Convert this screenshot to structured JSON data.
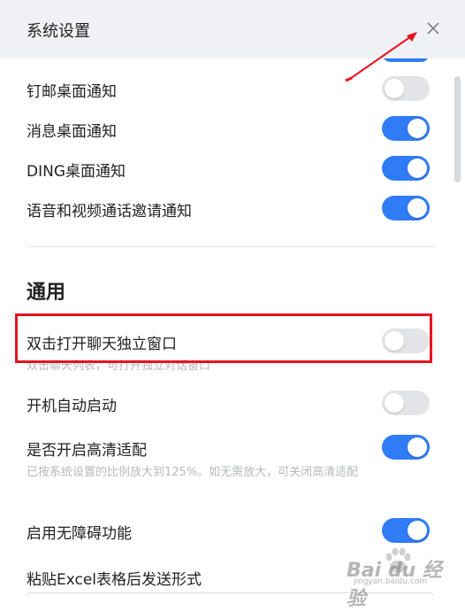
{
  "window": {
    "title": "系统设置"
  },
  "notifications": [
    {
      "label": "钉邮桌面通知",
      "enabled": false
    },
    {
      "label": "消息桌面通知",
      "enabled": true
    },
    {
      "label": "DING桌面通知",
      "enabled": true
    },
    {
      "label": "语音和视频通话邀请通知",
      "enabled": true
    }
  ],
  "general": {
    "section_title": "通用",
    "items": [
      {
        "label": "双击打开聊天独立窗口",
        "desc": "双击聊天列表，可打开独立对话窗口",
        "enabled": false
      },
      {
        "label": "开机自动启动",
        "enabled": false
      },
      {
        "label": "是否开启高清适配",
        "desc": "已按系统设置的比例放大到125%。如无需放大，可关闭高清适配",
        "enabled": true
      },
      {
        "label": "启用无障碍功能",
        "enabled": true
      },
      {
        "label": "粘贴Excel表格后发送形式"
      }
    ]
  },
  "colors": {
    "toggle_on": "#2f7cf6",
    "toggle_off": "#e3e4e7",
    "highlight": "#e8131f"
  },
  "watermark": {
    "logo_text": "Bai du 经验",
    "url": "jingyan.baidu.com"
  }
}
